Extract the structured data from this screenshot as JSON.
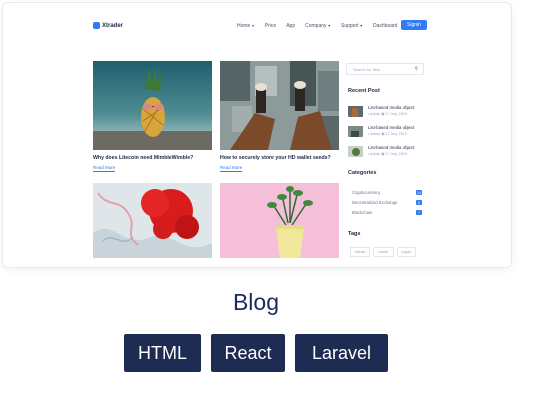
{
  "preview": {
    "nav": {
      "logo": "Xtrader",
      "links": [
        {
          "label": "Home",
          "caret": true
        },
        {
          "label": "Price",
          "caret": false
        },
        {
          "label": "App",
          "caret": false
        },
        {
          "label": "Company",
          "caret": true
        },
        {
          "label": "Support",
          "caret": true
        },
        {
          "label": "Dashboard",
          "caret": false
        }
      ],
      "signin": "Signin"
    },
    "posts": [
      {
        "title": "Why does Litecoin need MimbleWimble?",
        "link": "Read More",
        "image": "pineapple-sunglasses"
      },
      {
        "title": "How to securely store your HD wallet seeds?",
        "link": "Read More",
        "image": "feet-over-city"
      },
      {
        "title": "",
        "link": "",
        "image": "red-ink-splash"
      },
      {
        "title": "",
        "link": "",
        "image": "potted-plant-pink"
      }
    ],
    "sidebar": {
      "search_placeholder": "Search for Item",
      "recent_heading": "Recent Post",
      "recent": [
        {
          "title": "List-based media object",
          "meta": "• Admin  ▣ 17 July, 2019"
        },
        {
          "title": "List-based media object",
          "meta": "• Admin  ▣ 17 July, 2019"
        },
        {
          "title": "List-based media object",
          "meta": "• Admin  ▣ 17 July, 2019"
        }
      ],
      "categories_heading": "Categories",
      "categories": [
        {
          "name": "Cryptocurrency",
          "count": "14"
        },
        {
          "name": "Decentralized Exchange",
          "count": "9"
        },
        {
          "name": "Blockchain",
          "count": "7"
        }
      ],
      "tags_heading": "Tags",
      "tags": [
        "bitcoin",
        "xrader",
        "crypto"
      ]
    }
  },
  "heading": "Blog",
  "technologies": [
    "HTML",
    "React",
    "Laravel"
  ],
  "colors": {
    "accent": "#2f7cf6",
    "navy": "#1e2b52",
    "heading": "#1f2a5c"
  }
}
